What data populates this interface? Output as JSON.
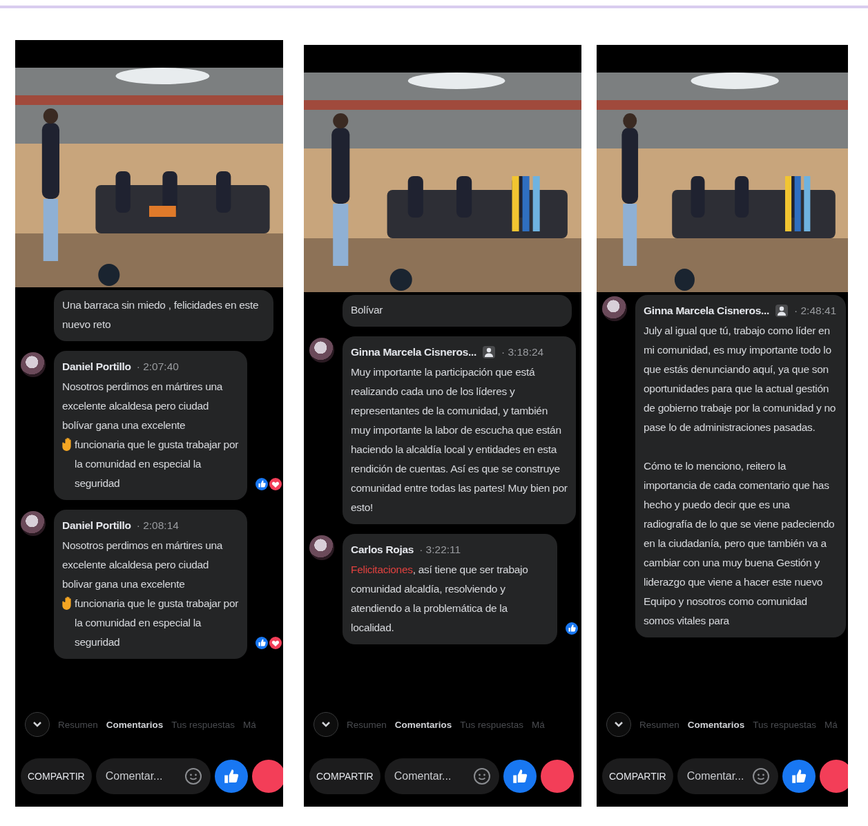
{
  "phones": [
    {
      "partial_comment": "Una barraca sin miedo , felicidades en este nuevo reto",
      "comments": [
        {
          "author": "Daniel Portillo",
          "time": "· 2:07:40",
          "paragraphs": [
            [
              {
                "kind": "text",
                "text": "Nosotros perdimos en mártires una excelente alcaldesa pero ciudad bolívar gana una excelente"
              },
              {
                "kind": "emoji",
                "text": "funcionaria que le gusta trabajar por la comunidad en especial la seguridad"
              }
            ]
          ],
          "liked": true,
          "loved": true
        },
        {
          "author": "Daniel Portillo",
          "time": "· 2:08:14",
          "paragraphs": [
            [
              {
                "kind": "text",
                "text": "Nosotros perdimos en mártires una excelente alcaldesa pero ciudad bolivar gana una excelente"
              },
              {
                "kind": "emoji",
                "text": "funcionaria que le gusta trabajar por la comunidad en especial la seguridad"
              }
            ]
          ],
          "liked": true,
          "loved": true
        }
      ],
      "tabs": [
        {
          "label": "Resumen",
          "selected": false
        },
        {
          "label": "Comentarios",
          "selected": true
        },
        {
          "label": "Tus respuestas",
          "selected": false
        },
        {
          "label": "Má",
          "selected": false
        }
      ],
      "share": "COMPARTIR",
      "comment_placeholder": "Comentar..."
    },
    {
      "partial_comment": "Bolívar",
      "comments": [
        {
          "author": "Ginna Marcela Cisneros...",
          "badge": true,
          "time": "· 3:18:24",
          "paragraphs": [
            [
              {
                "kind": "text",
                "text": "Muy importante la participación que está realizando cada uno de los líderes y representantes de la comunidad, y también muy importante la labor de escucha que están haciendo la alcaldía local y  entidades en esta rendición de cuentas. Así es que se construye comunidad entre todas las partes! Muy bien por esto!"
              }
            ]
          ]
        },
        {
          "author": "Carlos Rojas",
          "time": "· 3:22:11",
          "paragraphs": [
            [
              {
                "kind": "highlight",
                "text": "Felicitaciones"
              },
              {
                "kind": "text",
                "text": ", así tiene que ser trabajo comunidad alcaldía, resolviendo y atendiendo a la problemática de la localidad."
              }
            ]
          ],
          "liked": true
        }
      ],
      "tabs": [
        {
          "label": "Resumen",
          "selected": false
        },
        {
          "label": "Comentarios",
          "selected": true
        },
        {
          "label": "Tus respuestas",
          "selected": false
        },
        {
          "label": "Má",
          "selected": false
        }
      ],
      "share": "COMPARTIR",
      "comment_placeholder": "Comentar..."
    },
    {
      "comments": [
        {
          "author": "Ginna Marcela Cisneros...",
          "badge": true,
          "time": "· 2:48:41",
          "paragraphs": [
            [
              {
                "kind": "text",
                "text": "July al igual que tú, trabajo como líder en mi comunidad, es muy importante todo lo que estás denunciando aquí, ya que son oportunidades para que la actual gestión de gobierno trabaje por la comunidad y no pase lo de administraciones pasadas."
              }
            ],
            [
              {
                "kind": "text",
                "text": "Cómo te lo menciono, reitero la importancia de cada comentario que has hecho y puedo decir que es una radiografía de lo que se viene padeciendo en la ciudadanía, pero que también va a cambiar con una muy buena Gestión y liderazgo que viene a hacer este nuevo Equipo y nosotros como comunidad somos vitales para"
              }
            ]
          ]
        }
      ],
      "tabs": [
        {
          "label": "Resumen",
          "selected": false
        },
        {
          "label": "Comentarios",
          "selected": true
        },
        {
          "label": "Tus respuestas",
          "selected": false
        },
        {
          "label": "Má",
          "selected": false
        }
      ],
      "share": "COMPARTIR",
      "comment_placeholder": "Comentar..."
    }
  ]
}
